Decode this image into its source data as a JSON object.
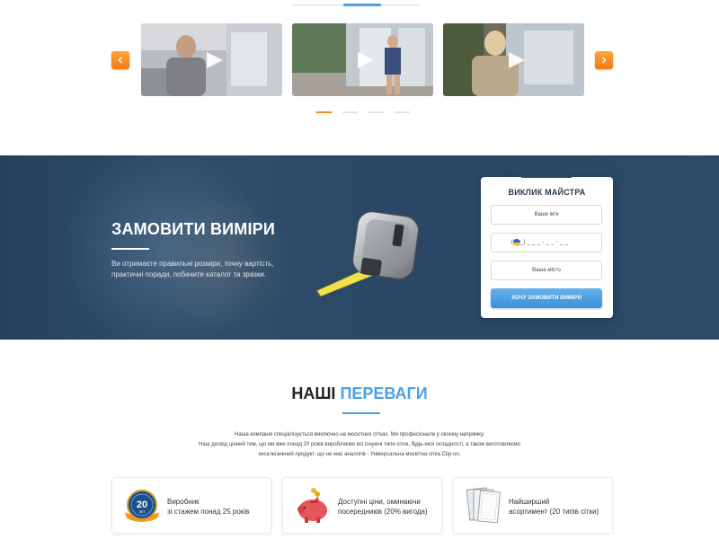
{
  "slider": {
    "videos": [
      {
        "label": "video-1"
      },
      {
        "label": "video-2"
      },
      {
        "label": "video-3"
      }
    ],
    "active_dot": 0,
    "dots_count": 4,
    "accent_color": "#f58a1f"
  },
  "banner": {
    "title": "ЗАМОВИТИ ВИМІРИ",
    "text": "Ви отримаєте правильні розміри, точну вартість, практичні поради, побачите каталог та зразки."
  },
  "form": {
    "title": "ВИКЛИК МАЙСТРА",
    "name_placeholder": "Ваше ім'я",
    "phone_placeholder": "(0__) _ _ _ - _ _ - _ _",
    "city_placeholder": "Ваше місто",
    "submit_label": "ХОЧУ ЗАМОВИТИ ВИМІРИ"
  },
  "advantages": {
    "title_part1": "НАШІ",
    "title_part2": "ПЕРЕВАГИ",
    "line1": "Наша компанія спеціалізується виключно на москітних сітках. Ми професіонали у своєму напрямку.",
    "line2": "Наш досвід цінний тим, що ми вже понад 20 років виробляємо всі існуючі типи сіток, будь-якої складності, а також виготовляємо",
    "line3": "ексклюзивний продукт, що не має аналогів - Універсальна москітна сітка Clip-on.",
    "badge_number": "20",
    "badge_word": "ЛЕТ",
    "cards": [
      {
        "line1": "Виробник",
        "line2": "зі стажем понад 25 років"
      },
      {
        "line1": "Доступні ціни, оминаючи",
        "line2": "посередників (20% вигода)"
      },
      {
        "line1": "Найширший",
        "line2": "асортимент (20 типів сітки)"
      }
    ],
    "accent_color": "#4aa2e4"
  }
}
